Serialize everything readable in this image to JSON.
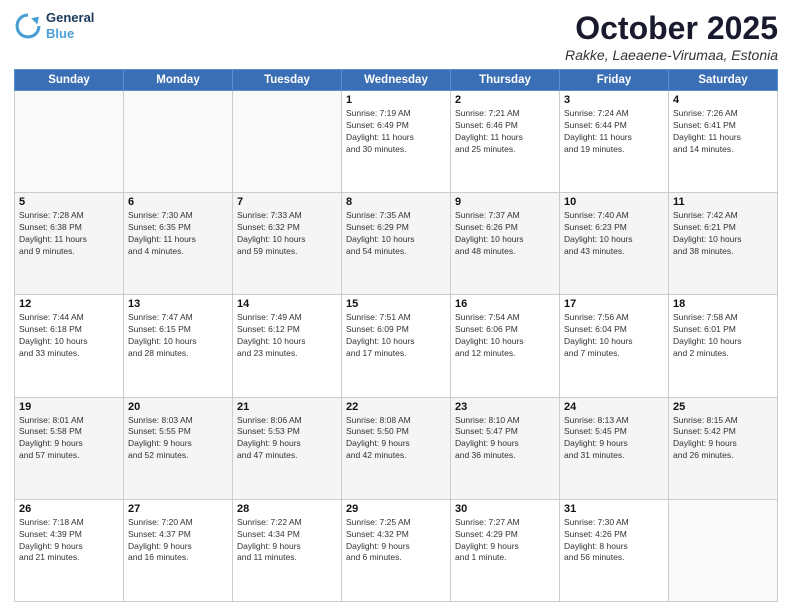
{
  "logo": {
    "line1": "General",
    "line2": "Blue"
  },
  "title": "October 2025",
  "location": "Rakke, Laeaene-Virumaa, Estonia",
  "days_header": [
    "Sunday",
    "Monday",
    "Tuesday",
    "Wednesday",
    "Thursday",
    "Friday",
    "Saturday"
  ],
  "weeks": [
    [
      {
        "day": "",
        "info": ""
      },
      {
        "day": "",
        "info": ""
      },
      {
        "day": "",
        "info": ""
      },
      {
        "day": "1",
        "info": "Sunrise: 7:19 AM\nSunset: 6:49 PM\nDaylight: 11 hours\nand 30 minutes."
      },
      {
        "day": "2",
        "info": "Sunrise: 7:21 AM\nSunset: 6:46 PM\nDaylight: 11 hours\nand 25 minutes."
      },
      {
        "day": "3",
        "info": "Sunrise: 7:24 AM\nSunset: 6:44 PM\nDaylight: 11 hours\nand 19 minutes."
      },
      {
        "day": "4",
        "info": "Sunrise: 7:26 AM\nSunset: 6:41 PM\nDaylight: 11 hours\nand 14 minutes."
      }
    ],
    [
      {
        "day": "5",
        "info": "Sunrise: 7:28 AM\nSunset: 6:38 PM\nDaylight: 11 hours\nand 9 minutes."
      },
      {
        "day": "6",
        "info": "Sunrise: 7:30 AM\nSunset: 6:35 PM\nDaylight: 11 hours\nand 4 minutes."
      },
      {
        "day": "7",
        "info": "Sunrise: 7:33 AM\nSunset: 6:32 PM\nDaylight: 10 hours\nand 59 minutes."
      },
      {
        "day": "8",
        "info": "Sunrise: 7:35 AM\nSunset: 6:29 PM\nDaylight: 10 hours\nand 54 minutes."
      },
      {
        "day": "9",
        "info": "Sunrise: 7:37 AM\nSunset: 6:26 PM\nDaylight: 10 hours\nand 48 minutes."
      },
      {
        "day": "10",
        "info": "Sunrise: 7:40 AM\nSunset: 6:23 PM\nDaylight: 10 hours\nand 43 minutes."
      },
      {
        "day": "11",
        "info": "Sunrise: 7:42 AM\nSunset: 6:21 PM\nDaylight: 10 hours\nand 38 minutes."
      }
    ],
    [
      {
        "day": "12",
        "info": "Sunrise: 7:44 AM\nSunset: 6:18 PM\nDaylight: 10 hours\nand 33 minutes."
      },
      {
        "day": "13",
        "info": "Sunrise: 7:47 AM\nSunset: 6:15 PM\nDaylight: 10 hours\nand 28 minutes."
      },
      {
        "day": "14",
        "info": "Sunrise: 7:49 AM\nSunset: 6:12 PM\nDaylight: 10 hours\nand 23 minutes."
      },
      {
        "day": "15",
        "info": "Sunrise: 7:51 AM\nSunset: 6:09 PM\nDaylight: 10 hours\nand 17 minutes."
      },
      {
        "day": "16",
        "info": "Sunrise: 7:54 AM\nSunset: 6:06 PM\nDaylight: 10 hours\nand 12 minutes."
      },
      {
        "day": "17",
        "info": "Sunrise: 7:56 AM\nSunset: 6:04 PM\nDaylight: 10 hours\nand 7 minutes."
      },
      {
        "day": "18",
        "info": "Sunrise: 7:58 AM\nSunset: 6:01 PM\nDaylight: 10 hours\nand 2 minutes."
      }
    ],
    [
      {
        "day": "19",
        "info": "Sunrise: 8:01 AM\nSunset: 5:58 PM\nDaylight: 9 hours\nand 57 minutes."
      },
      {
        "day": "20",
        "info": "Sunrise: 8:03 AM\nSunset: 5:55 PM\nDaylight: 9 hours\nand 52 minutes."
      },
      {
        "day": "21",
        "info": "Sunrise: 8:06 AM\nSunset: 5:53 PM\nDaylight: 9 hours\nand 47 minutes."
      },
      {
        "day": "22",
        "info": "Sunrise: 8:08 AM\nSunset: 5:50 PM\nDaylight: 9 hours\nand 42 minutes."
      },
      {
        "day": "23",
        "info": "Sunrise: 8:10 AM\nSunset: 5:47 PM\nDaylight: 9 hours\nand 36 minutes."
      },
      {
        "day": "24",
        "info": "Sunrise: 8:13 AM\nSunset: 5:45 PM\nDaylight: 9 hours\nand 31 minutes."
      },
      {
        "day": "25",
        "info": "Sunrise: 8:15 AM\nSunset: 5:42 PM\nDaylight: 9 hours\nand 26 minutes."
      }
    ],
    [
      {
        "day": "26",
        "info": "Sunrise: 7:18 AM\nSunset: 4:39 PM\nDaylight: 9 hours\nand 21 minutes."
      },
      {
        "day": "27",
        "info": "Sunrise: 7:20 AM\nSunset: 4:37 PM\nDaylight: 9 hours\nand 16 minutes."
      },
      {
        "day": "28",
        "info": "Sunrise: 7:22 AM\nSunset: 4:34 PM\nDaylight: 9 hours\nand 11 minutes."
      },
      {
        "day": "29",
        "info": "Sunrise: 7:25 AM\nSunset: 4:32 PM\nDaylight: 9 hours\nand 6 minutes."
      },
      {
        "day": "30",
        "info": "Sunrise: 7:27 AM\nSunset: 4:29 PM\nDaylight: 9 hours\nand 1 minute."
      },
      {
        "day": "31",
        "info": "Sunrise: 7:30 AM\nSunset: 4:26 PM\nDaylight: 8 hours\nand 56 minutes."
      },
      {
        "day": "",
        "info": ""
      }
    ]
  ]
}
